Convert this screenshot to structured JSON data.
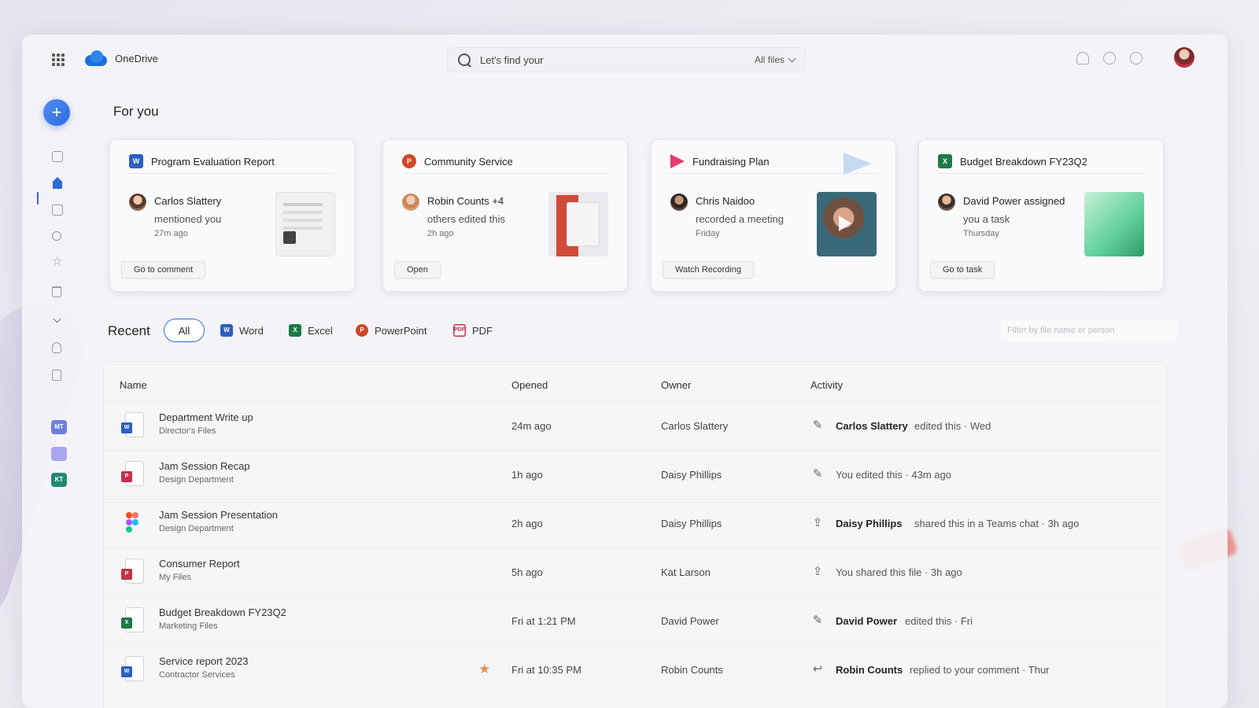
{
  "app": {
    "name": "OneDrive"
  },
  "search": {
    "placeholder": "Let's find your",
    "scope": "All files"
  },
  "section_title": "For you",
  "cards": [
    {
      "title": "Program Evaluation Report",
      "person": "Carlos Slattery",
      "action": "mentioned you",
      "time": "27m ago",
      "button": "Go to comment",
      "file_icon": "word-icon"
    },
    {
      "title": "Community Service",
      "person": "Robin Counts +4",
      "action": "others edited this",
      "time": "2h ago",
      "button": "Open",
      "file_icon": "powerpoint-icon"
    },
    {
      "title": "Fundraising Plan",
      "person": "Chris Naidoo",
      "action": "recorded a meeting",
      "time": "Friday",
      "button": "Watch Recording",
      "file_icon": "stream-icon"
    },
    {
      "title": "Budget Breakdown FY23Q2",
      "person": "David Power assigned",
      "action": "you a task",
      "time": "Thursday",
      "button": "Go to task",
      "file_icon": "excel-icon"
    }
  ],
  "recent": {
    "label": "Recent",
    "filters": [
      "All",
      "Word",
      "Excel",
      "PowerPoint",
      "PDF"
    ],
    "filter_placeholder": "Filter by file name or person"
  },
  "table": {
    "headers": {
      "name": "Name",
      "opened": "Opened",
      "owner": "Owner",
      "activity": "Activity"
    },
    "rows": [
      {
        "name": "Department Write up",
        "location": "Director's Files",
        "opened": "24m ago",
        "owner": "Carlos Slattery",
        "actor": "Carlos Slattery",
        "activity": "edited this · Wed",
        "type": "word",
        "activity_icon": "pencil-icon"
      },
      {
        "name": "Jam Session Recap",
        "location": "Design Department",
        "opened": "1h ago",
        "owner": "Daisy Phillips",
        "actor": "",
        "activity": "You edited this · 43m ago",
        "type": "pdf",
        "activity_icon": "pencil-icon"
      },
      {
        "name": "Jam Session Presentation",
        "location": "Design Department",
        "opened": "2h ago",
        "owner": "Daisy Phillips",
        "actor": "Daisy Phillips",
        "activity": "shared this in a Teams chat · 3h ago",
        "type": "figma",
        "activity_icon": "share-icon"
      },
      {
        "name": "Consumer Report",
        "location": "My Files",
        "opened": "5h ago",
        "owner": "Kat Larson",
        "actor": "",
        "activity": "You shared this file · 3h ago",
        "type": "pdf",
        "activity_icon": "share-icon"
      },
      {
        "name": "Budget Breakdown FY23Q2",
        "location": "Marketing Files",
        "opened": "Fri at 1:21 PM",
        "owner": "David Power",
        "actor": "David Power",
        "activity": "edited this · Fri",
        "type": "excel",
        "activity_icon": "pencil-icon"
      },
      {
        "name": "Service report 2023",
        "location": "Contractor Services",
        "opened": "Fri at 10:35 PM",
        "owner": "Robin Counts",
        "actor": "Robin Counts",
        "activity": "replied to your comment · Thur",
        "type": "word",
        "activity_icon": "reply-icon",
        "favorite": true
      }
    ]
  },
  "sidebar": {
    "apps": [
      {
        "label": "MT",
        "color": "#6b7fe0"
      },
      {
        "label": "",
        "color": "#a9a6f0"
      },
      {
        "label": "KT",
        "color": "#1e8a74"
      }
    ]
  },
  "colors": {
    "accent": "#2d6ad9",
    "word": "#2b5fc4",
    "excel": "#1d7a45",
    "powerpoint": "#d24726",
    "pdf": "#c4314b"
  }
}
